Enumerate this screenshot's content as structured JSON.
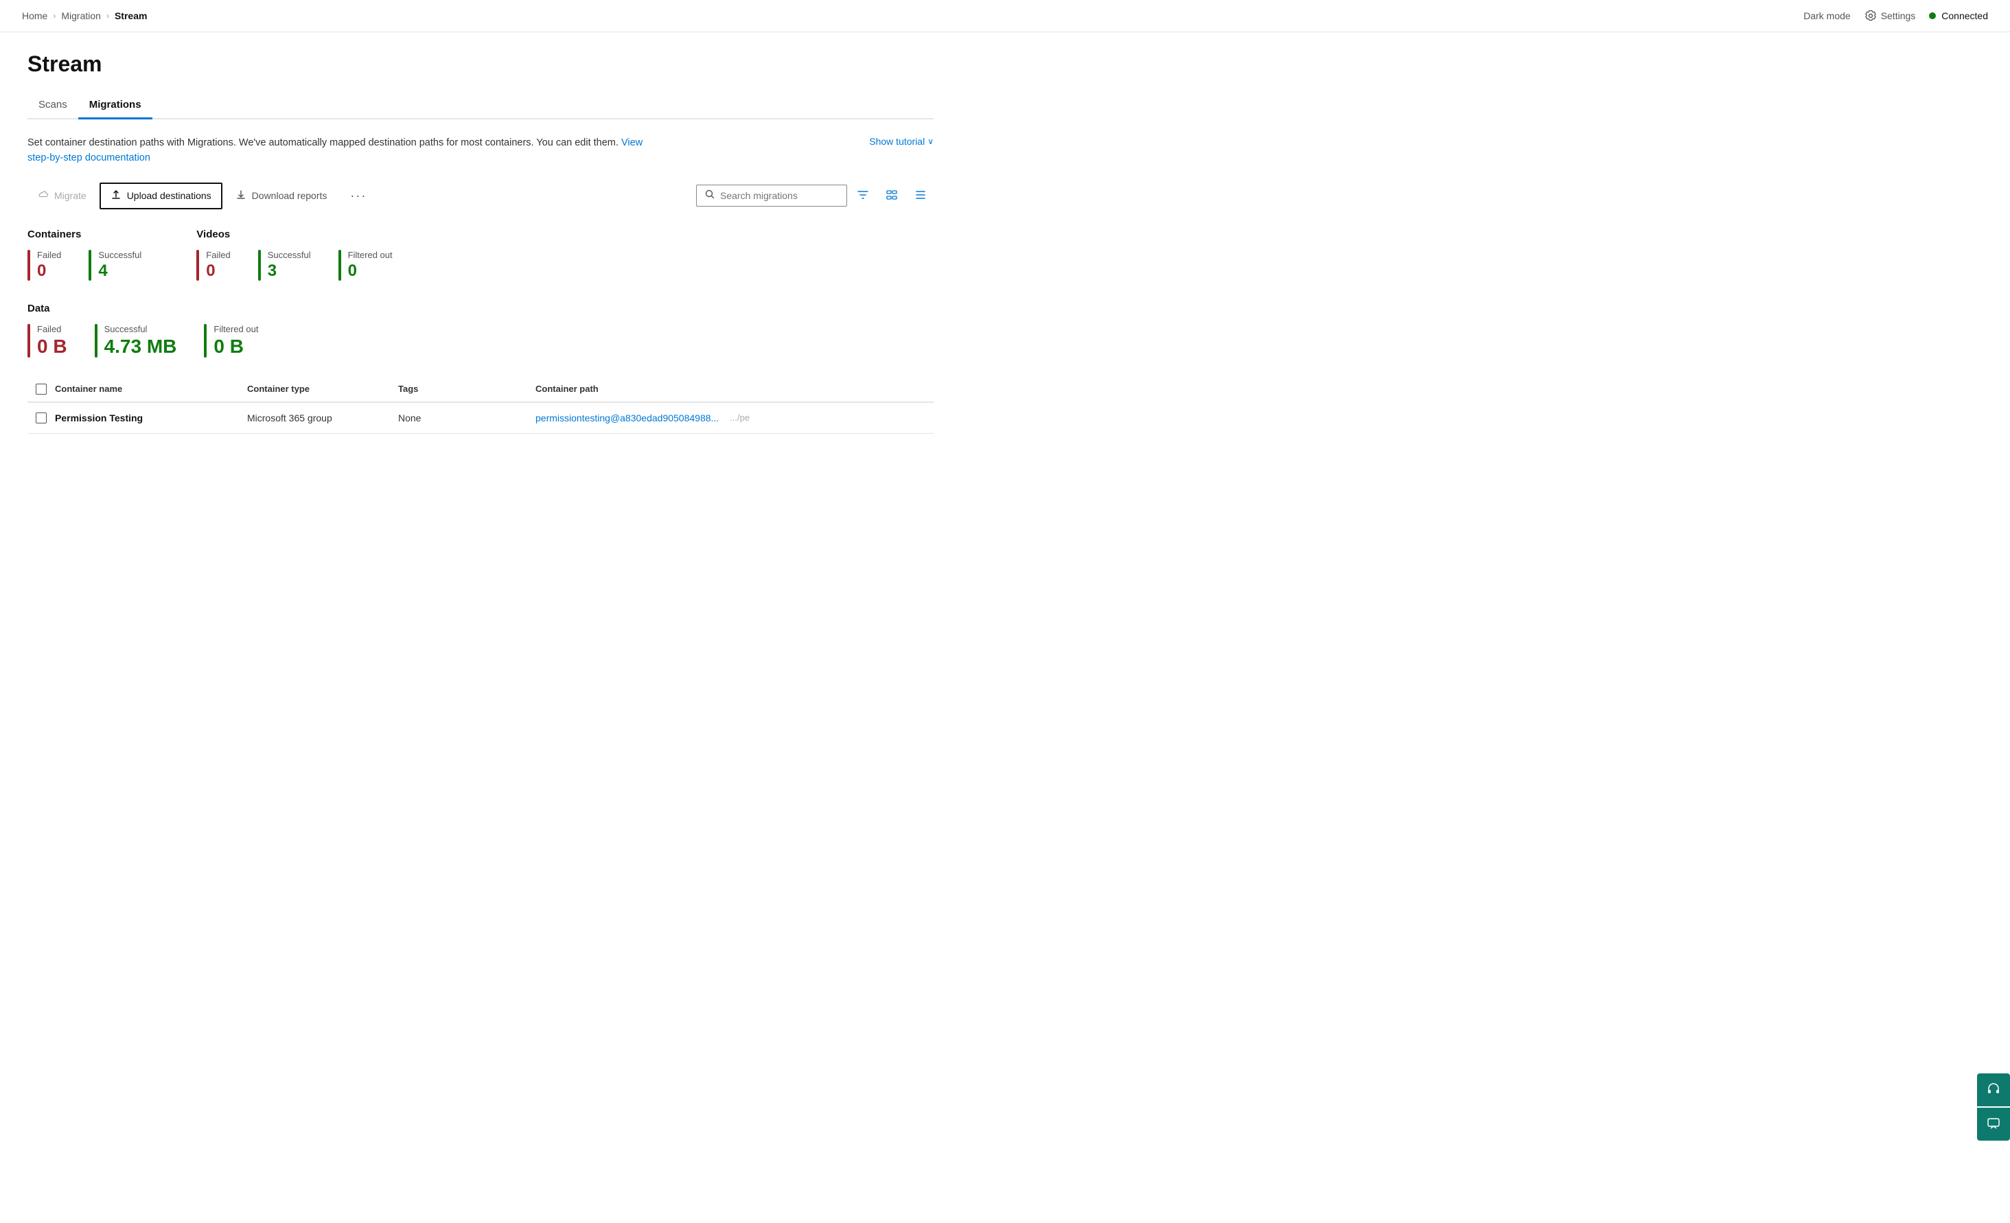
{
  "breadcrumb": {
    "home": "Home",
    "migration": "Migration",
    "current": "Stream"
  },
  "topbar": {
    "dark_mode": "Dark mode",
    "settings": "Settings",
    "connected": "Connected"
  },
  "page": {
    "title": "Stream"
  },
  "tabs": [
    {
      "id": "scans",
      "label": "Scans",
      "active": false
    },
    {
      "id": "migrations",
      "label": "Migrations",
      "active": true
    }
  ],
  "description": {
    "text_before": "Set container destination paths with Migrations. We've automatically mapped destination paths for most containers. You can edit them.",
    "link_text": "View step-by-step documentation",
    "link_href": "#",
    "show_tutorial": "Show tutorial"
  },
  "toolbar": {
    "migrate_label": "Migrate",
    "upload_destinations_label": "Upload destinations",
    "download_reports_label": "Download reports",
    "more_label": "···",
    "search_placeholder": "Search migrations",
    "filter_label": "Filter",
    "group_label": "Group",
    "columns_label": "Columns"
  },
  "stats": {
    "containers_title": "Containers",
    "containers": [
      {
        "label": "Failed",
        "value": "0",
        "color": "red"
      },
      {
        "label": "Successful",
        "value": "4",
        "color": "green"
      }
    ],
    "videos_title": "Videos",
    "videos": [
      {
        "label": "Failed",
        "value": "0",
        "color": "red"
      },
      {
        "label": "Successful",
        "value": "3",
        "color": "green"
      },
      {
        "label": "Filtered out",
        "value": "0",
        "color": "green"
      }
    ],
    "data_title": "Data",
    "data": [
      {
        "label": "Failed",
        "value": "0 B",
        "color": "red"
      },
      {
        "label": "Successful",
        "value": "4.73 MB",
        "color": "green"
      },
      {
        "label": "Filtered out",
        "value": "0 B",
        "color": "green"
      }
    ]
  },
  "table": {
    "headers": [
      {
        "id": "checkbox",
        "label": ""
      },
      {
        "id": "container-name",
        "label": "Container name"
      },
      {
        "id": "container-type",
        "label": "Container type"
      },
      {
        "id": "tags",
        "label": "Tags"
      },
      {
        "id": "container-path",
        "label": "Container path"
      }
    ],
    "rows": [
      {
        "checkbox": false,
        "container_name": "Permission Testing",
        "container_type": "Microsoft 365 group",
        "tags": "None",
        "container_path": "permissiontesting@a830edad905084988...",
        "container_path_suffix": ".../pe"
      }
    ]
  },
  "side_panel": {
    "chat_icon": "headset",
    "message_icon": "message"
  }
}
